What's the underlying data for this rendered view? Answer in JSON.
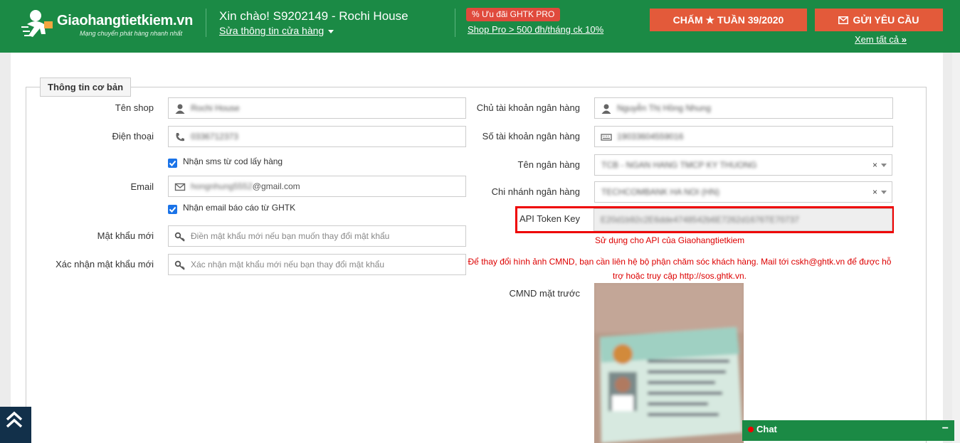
{
  "header": {
    "logo_text": "Giaohangtietkiem.vn",
    "logo_slogan": "Mạng chuyển phát hàng nhanh nhất",
    "greeting": "Xin chào! S9202149 - Rochi House",
    "edit_shop": "Sửa thông tin cửa hàng",
    "pro_badge": "Ưu đãi GHTK PRO",
    "pro_badge_icon": "%",
    "pro_link": "Shop Pro > 500 đh/tháng ck 10%",
    "week_button_prefix": "CHẤM",
    "week_button_suffix": "TUẦN 39/2020",
    "request_button": "GỬI YÊU CẦU",
    "see_all": "Xem tất cả"
  },
  "section": {
    "legend": "Thông tin cơ bản"
  },
  "left": {
    "shop_name": {
      "label": "Tên shop",
      "value": "Rochi House"
    },
    "phone": {
      "label": "Điện thoại",
      "value": "0336712373"
    },
    "sms_checkbox": {
      "label": "Nhận sms từ cod lấy hàng",
      "checked": true
    },
    "email": {
      "label": "Email",
      "value_hidden": "hongnhung5552",
      "value_domain": "@gmail.com"
    },
    "email_checkbox": {
      "label": "Nhận email báo cáo từ GHTK",
      "checked": true
    },
    "new_password": {
      "label": "Mật khẩu mới",
      "placeholder": "Điền mật khẩu mới nếu bạn muốn thay đổi mật khẩu"
    },
    "confirm_password": {
      "label": "Xác nhận mật khẩu mới",
      "placeholder": "Xác nhận mật khẩu mới nếu bạn thay đổi mật khẩu"
    }
  },
  "right": {
    "account_holder": {
      "label": "Chủ tài khoản ngân hàng",
      "value": "Nguyễn Thị Hồng Nhung"
    },
    "account_number": {
      "label": "Số tài khoản ngân hàng",
      "value": "19033604559016"
    },
    "bank_name": {
      "label": "Tên ngân hàng",
      "value": "TCB - NGAN HANG TMCP KY THUONG",
      "clear": "×"
    },
    "branch": {
      "label": "Chi nhánh ngân hàng",
      "value": "TECHCOMBANK HA NOI (HN)",
      "clear": "×"
    },
    "api_token": {
      "label": "API Token Key",
      "value": "E20d1b92c2E6dde4748542b6E7262d1676TE70737",
      "note": "Sử dụng cho API của Giaohangtietkiem"
    },
    "notice": "Để thay đổi hình ảnh CMND, bạn cần liên hệ bộ phận chăm sóc khách hàng. Mail tới cskh@ghtk.vn để được hỗ trợ hoặc truy cập http://sos.ghtk.vn.",
    "id_front_label": "CMND mặt trước"
  },
  "chat": {
    "label": "Chat",
    "minimize": "−"
  },
  "colors": {
    "header_bg": "#1b8a45",
    "button_orange": "#e35a3a",
    "highlight_red": "#ee0000",
    "checkbox_blue": "#1a73e8"
  }
}
